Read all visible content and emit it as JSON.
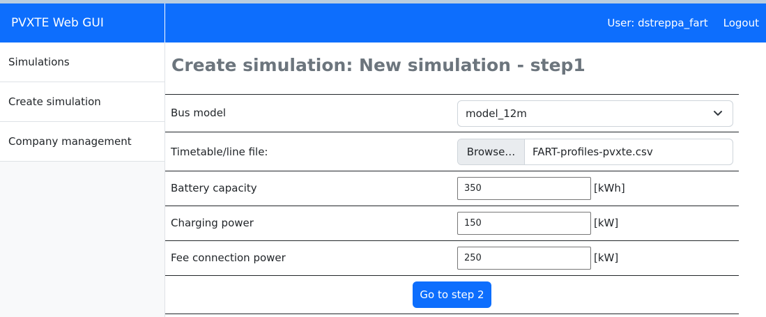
{
  "app": {
    "brand": "PVXTE Web GUI"
  },
  "navbar": {
    "user": "User: dstreppa_fart",
    "logout": "Logout"
  },
  "sidebar": {
    "items": [
      {
        "label": "Simulations"
      },
      {
        "label": "Create simulation"
      },
      {
        "label": "Company management"
      }
    ]
  },
  "page": {
    "title": "Create simulation: New simulation - step1"
  },
  "form": {
    "bus_model": {
      "label": "Bus model",
      "value": "model_12m"
    },
    "timetable": {
      "label": "Timetable/line file:",
      "browse": "Browse…",
      "file": "FART-profiles-pvxte.csv"
    },
    "battery": {
      "label": "Battery capacity",
      "value": "350",
      "unit": "[kWh]"
    },
    "charging": {
      "label": "Charging power",
      "value": "150",
      "unit": "[kW]"
    },
    "fee": {
      "label": "Fee connection power",
      "value": "250",
      "unit": "[kW]"
    },
    "submit": "Go to step 2"
  },
  "colors": {
    "primary": "#0d6efd",
    "title_gray": "#6c757d",
    "sidebar_bg": "#f8f9fa"
  }
}
